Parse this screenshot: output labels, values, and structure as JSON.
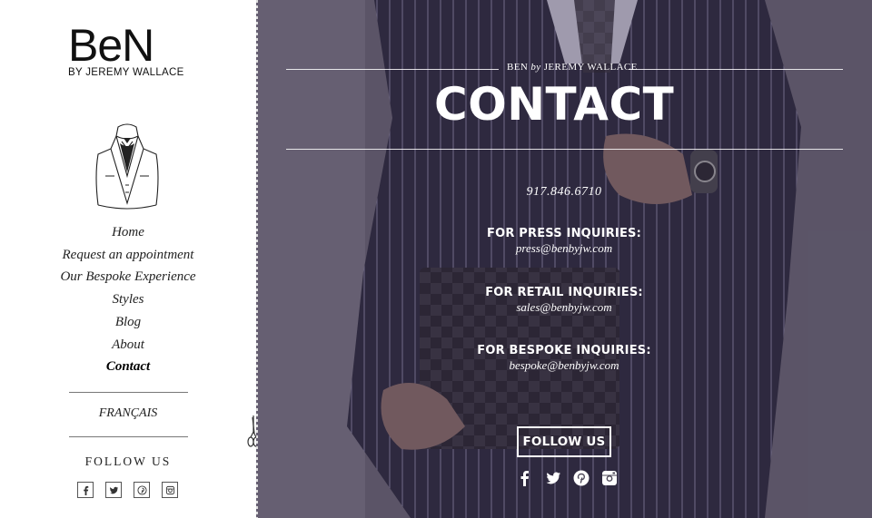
{
  "brand": {
    "logo_word": "BeN",
    "logo_sub": "BY JEREMY WALLACE"
  },
  "nav": {
    "items": [
      {
        "label": "Home",
        "active": false
      },
      {
        "label": "Request an appointment",
        "active": false
      },
      {
        "label": "Our Bespoke Experience",
        "active": false
      },
      {
        "label": "Styles",
        "active": false
      },
      {
        "label": "Blog",
        "active": false
      },
      {
        "label": "About",
        "active": false
      },
      {
        "label": "Contact",
        "active": true
      }
    ]
  },
  "language": {
    "label": "FRANÇAIS"
  },
  "sidebar_follow": {
    "label": "FOLLOW US",
    "icons": [
      "facebook-icon",
      "twitter-icon",
      "pinterest-icon",
      "instagram-icon"
    ]
  },
  "hero": {
    "brand_prefix": "BEN",
    "brand_by": "by",
    "brand_name": "JEREMY WALLACE",
    "title": "CONTACT",
    "phone": "917.846.6710",
    "inquiries": [
      {
        "heading": "FOR PRESS INQUIRIES:",
        "email": "press@benbyjw.com"
      },
      {
        "heading": "FOR RETAIL INQUIRIES:",
        "email": "sales@benbyjw.com"
      },
      {
        "heading": "FOR BESPOKE INQUIRIES:",
        "email": "bespoke@benbyjw.com"
      }
    ],
    "follow_button": "FOLLOW US",
    "social_icons": [
      "facebook-icon",
      "twitter-icon",
      "pinterest-icon",
      "instagram-icon"
    ]
  },
  "colors": {
    "hero_overlay": "#5b5566",
    "text_light": "#ffffff",
    "text_dark": "#111111"
  }
}
